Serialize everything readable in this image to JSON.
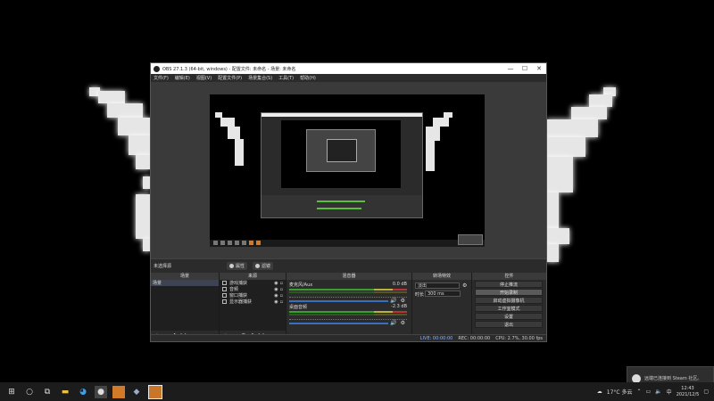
{
  "window": {
    "title": "OBS 27.1.3 (64-bit, windows) - 配置文件: 未命名 - 场景: 未命名",
    "minimize": "—",
    "maximize": "☐",
    "close": "✕"
  },
  "menu": [
    "文件(F)",
    "编辑(E)",
    "视图(V)",
    "配置文件(P)",
    "场景集合(S)",
    "工具(T)",
    "帮助(H)"
  ],
  "scene_bar": {
    "current_scene": "未选择源",
    "properties": "属性",
    "filters": "滤镜"
  },
  "docks": {
    "scenes": {
      "header": "场景",
      "items": [
        "场景"
      ]
    },
    "sources": {
      "header": "来源",
      "items": [
        "游戏捕获",
        "音频",
        "窗口捕获",
        "显示器捕获"
      ]
    },
    "mixer": {
      "header": "混音器",
      "channels": [
        {
          "name": "麦克风/Aux",
          "db": "0.0 dB"
        },
        {
          "name": "桌面音频",
          "db": "-2.3 dB"
        }
      ]
    },
    "transitions": {
      "header": "转场特效",
      "type": "淡出",
      "duration_label": "时长",
      "duration": "300 ms"
    },
    "controls": {
      "header": "控件",
      "buttons": [
        "停止推流",
        "开始录制",
        "启动虚拟摄像机",
        "工作室模式",
        "设置",
        "退出"
      ]
    }
  },
  "status": {
    "live": "LIVE: 00:00:00",
    "rec": "REC: 00:00:00",
    "cpu": "CPU: 2.7%, 30.00 fps"
  },
  "taskbar": {
    "weather": "17°C 多云",
    "ime": "中",
    "time": "12:43",
    "date": "2021/12/5"
  },
  "toast": {
    "text": "远端已连接到 Steam 社区。"
  },
  "colors": {
    "meter_green": "#3c9e2e",
    "meter_yellow": "#b9b33a",
    "meter_red": "#bb3333",
    "slider_blue": "#3a6fbf"
  }
}
